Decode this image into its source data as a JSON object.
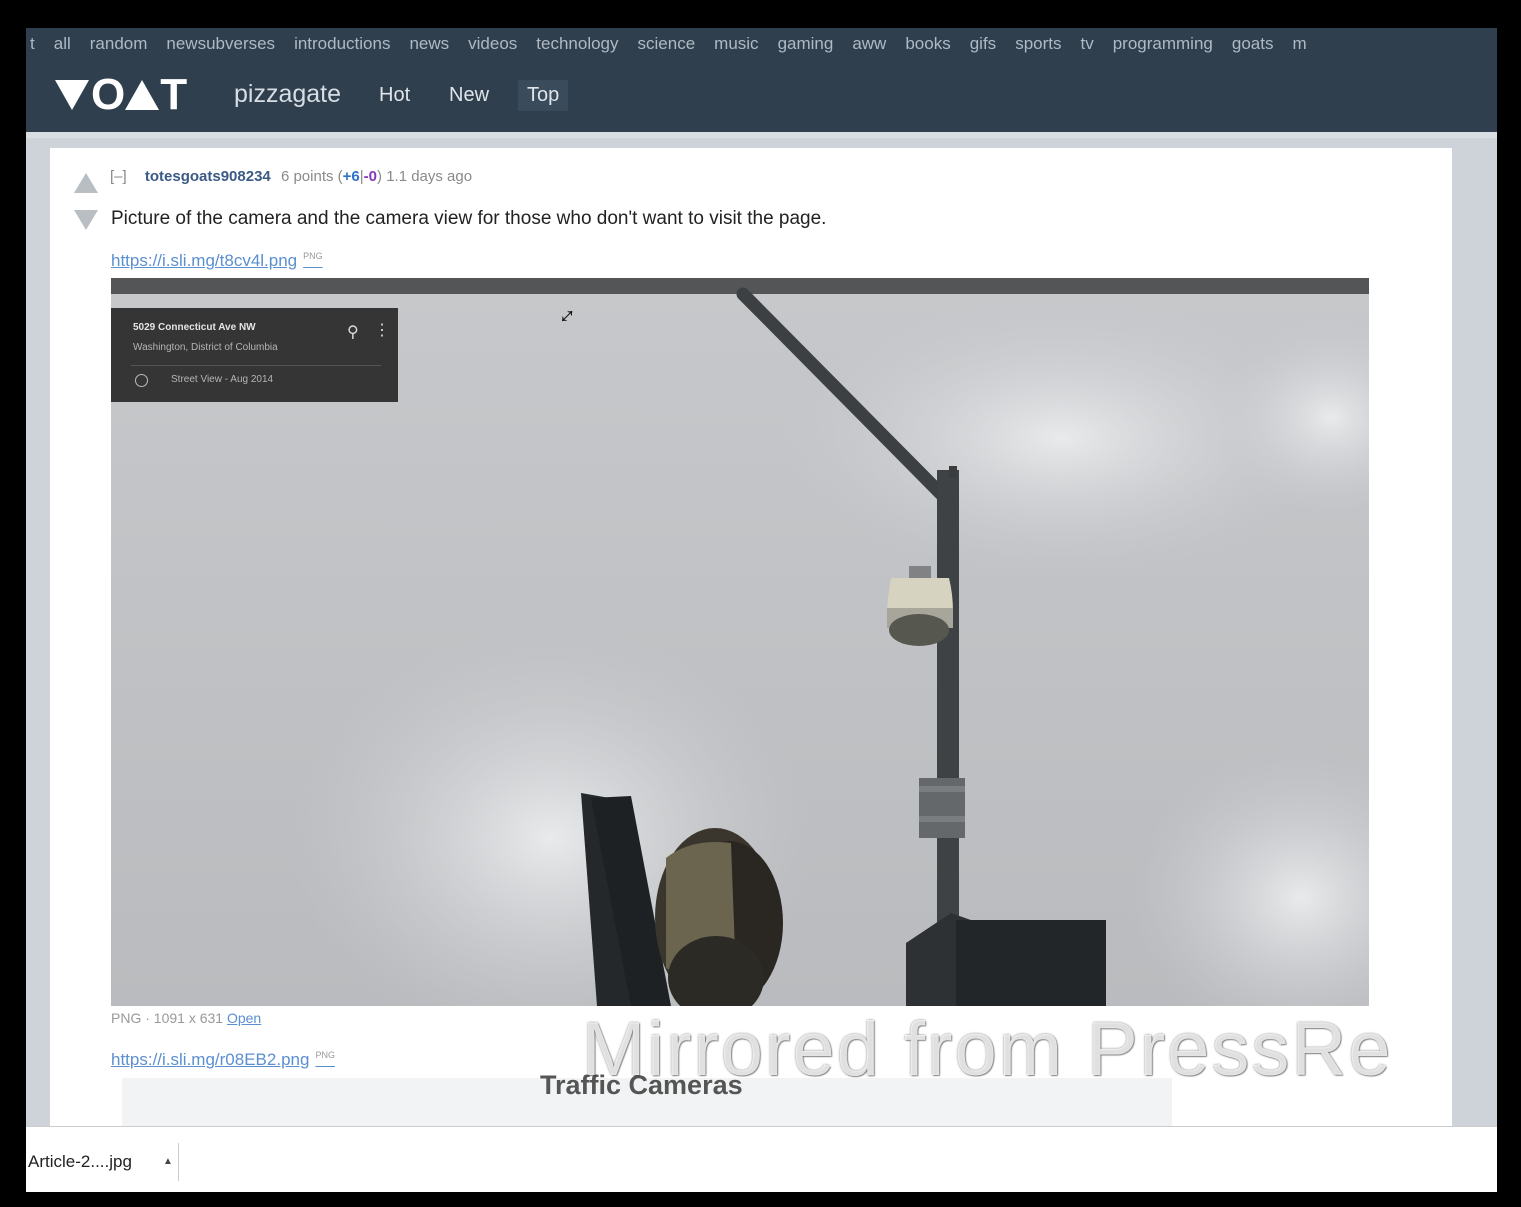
{
  "subnav": [
    "t",
    "all",
    "random",
    "newsubverses",
    "introductions",
    "news",
    "videos",
    "technology",
    "science",
    "music",
    "gaming",
    "aww",
    "books",
    "gifs",
    "sports",
    "tv",
    "programming",
    "goats",
    "m"
  ],
  "header": {
    "logo_text": "VOAT",
    "subverse": "pizzagate",
    "tabs": [
      {
        "label": "Hot",
        "active": false
      },
      {
        "label": "New",
        "active": false
      },
      {
        "label": "Top",
        "active": true
      }
    ]
  },
  "post": {
    "collapse": "[–]",
    "username": "totesgoats908234",
    "points": "6",
    "points_label": "points",
    "upvotes": "+6",
    "downvotes": "-0",
    "age": "1.1 days ago",
    "text": "Picture of the camera and the camera view for those who don't want to visit the page.",
    "link1": "https://i.sli.mg/t8cv4l.png",
    "link1_badge": "PNG",
    "link2": "https://i.sli.mg/r08EB2.png",
    "link2_badge": "PNG",
    "image_info": "PNG · 1091 x 631",
    "image_open": "Open"
  },
  "street_view": {
    "address": "5029 Connecticut Ave NW",
    "city": "Washington, District of Columbia",
    "date": "Street View - Aug 2014"
  },
  "embed_next_title": "Traffic Cameras",
  "watermark": "Mirrored from PressRe",
  "download": {
    "filename": "Article-2....jpg",
    "caret": "▲"
  }
}
